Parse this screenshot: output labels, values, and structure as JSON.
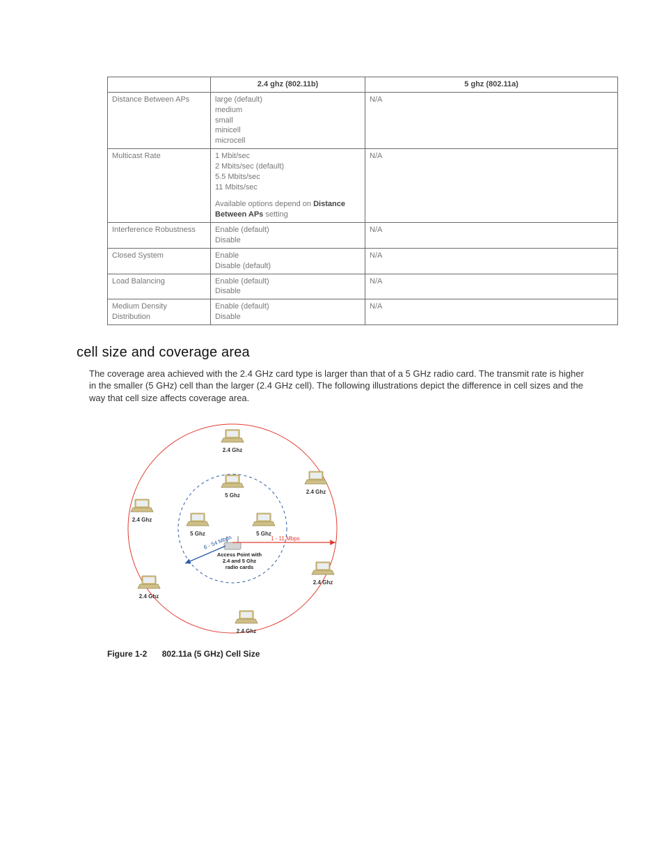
{
  "table": {
    "headers": [
      "",
      "2.4 ghz (802.11b)",
      "5 ghz (802.11a)"
    ],
    "rows": [
      {
        "name": "Distance Between APs",
        "col2_lines": [
          "large (default)",
          "medium",
          "small",
          "minicell",
          "microcell"
        ],
        "col2_note": "",
        "col3": "N/A"
      },
      {
        "name": "Multicast Rate",
        "col2_lines": [
          "1 Mbit/sec",
          "2 Mbits/sec (default)",
          "5.5 Mbits/sec",
          "11 Mbits/sec"
        ],
        "col2_note_prefix": "Available options depend on ",
        "col2_note_strong": "Distance Between APs",
        "col2_note_suffix": " setting",
        "col3": "N/A"
      },
      {
        "name": "Interference Robustness",
        "col2_lines": [
          "Enable (default)",
          "Disable"
        ],
        "col3": "N/A"
      },
      {
        "name": "Closed System",
        "col2_lines": [
          "Enable",
          "Disable (default)"
        ],
        "col3": "N/A"
      },
      {
        "name": "Load Balancing",
        "col2_lines": [
          "Enable (default)",
          "Disable"
        ],
        "col3": "N/A"
      },
      {
        "name": "Medium Density Distribution",
        "col2_lines": [
          "Enable (default)",
          "Disable"
        ],
        "col3": "N/A"
      }
    ]
  },
  "section": {
    "heading": "cell size and coverage area",
    "paragraph": "The coverage area achieved with the 2.4 GHz card type is larger than that of a 5 GHz radio card. The transmit rate is higher in the smaller (5 GHz) cell than the larger (2.4 GHz cell). The following illustrations depict the difference in cell sizes and the way that cell size affects coverage area."
  },
  "diagram": {
    "outer_label": "2.4 Ghz",
    "inner_label": "5 Ghz",
    "center_lines": [
      "Access Point with",
      "2.4 and 5 Ghz",
      "radio cards"
    ],
    "range_red": "1 - 11 Mbps",
    "range_blue": "6 - 54 Mbps",
    "colors": {
      "outer": "#e03c2f",
      "inner": "#2a5aa8"
    }
  },
  "figure": {
    "label": "Figure 1-2",
    "title": "802.11a (5 GHz) Cell Size"
  }
}
